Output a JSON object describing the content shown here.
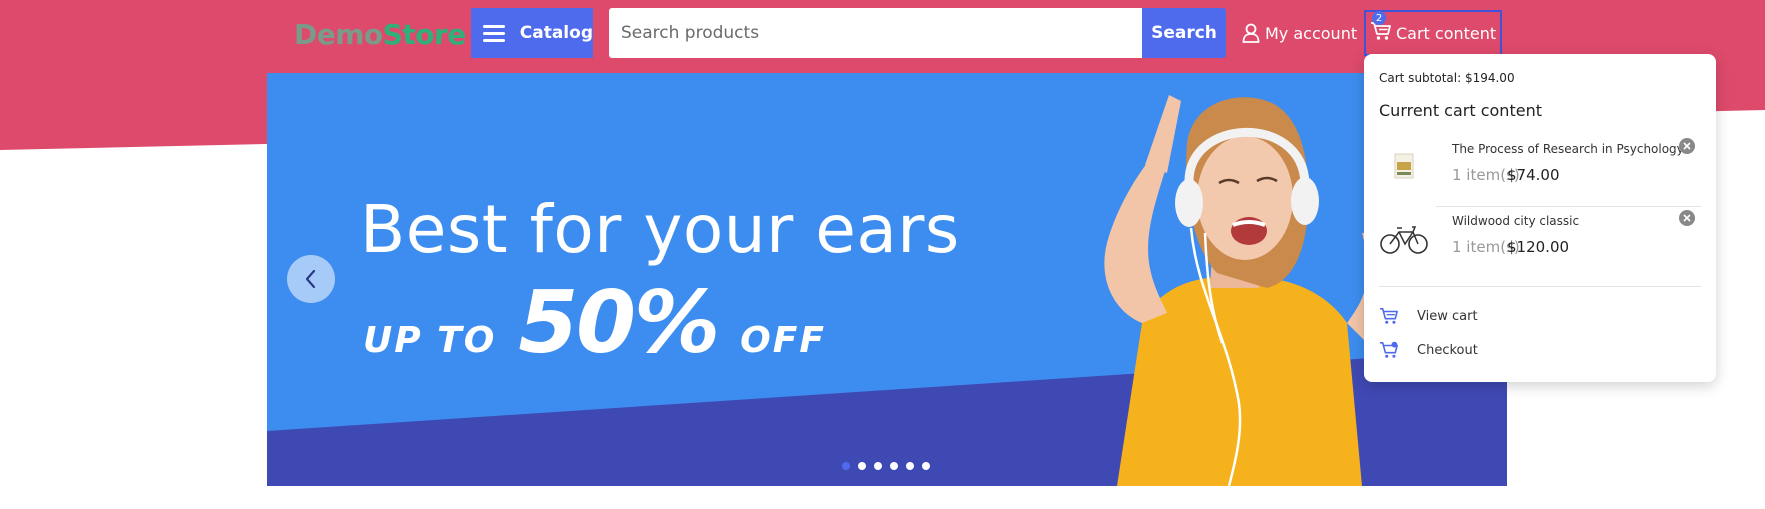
{
  "header": {
    "logo_part1": "Demo",
    "logo_part2": "Store",
    "catalog_label": "Catalog",
    "search_placeholder": "Search products",
    "search_button": "Search",
    "account_label": "My account",
    "cart_label": "Cart content",
    "cart_count": "2"
  },
  "banner": {
    "title": "Best for your ears",
    "offer_prefix": "UP TO",
    "offer_value": "50%",
    "offer_suffix": "OFF",
    "slide_count": 6,
    "active_slide": 1
  },
  "cart_dropdown": {
    "subtotal": "Cart subtotal: $194.00",
    "heading": "Current cart content",
    "items": [
      {
        "name": "The Process of Research in Psychology",
        "qty": "1 item(s)",
        "price": "$74.00",
        "icon": "book-thumbnail"
      },
      {
        "name": "Wildwood city classic",
        "qty": "1 item(s)",
        "price": "$120.00",
        "icon": "bicycle-thumbnail"
      }
    ],
    "view_cart": "View cart",
    "checkout": "Checkout"
  },
  "colors": {
    "header_pink": "#dd4a6b",
    "accent_blue": "#4f6bed",
    "banner_blue": "#3d8df0",
    "banner_dark_blue": "#3f49b3",
    "shirt_yellow": "#f6b21c"
  }
}
